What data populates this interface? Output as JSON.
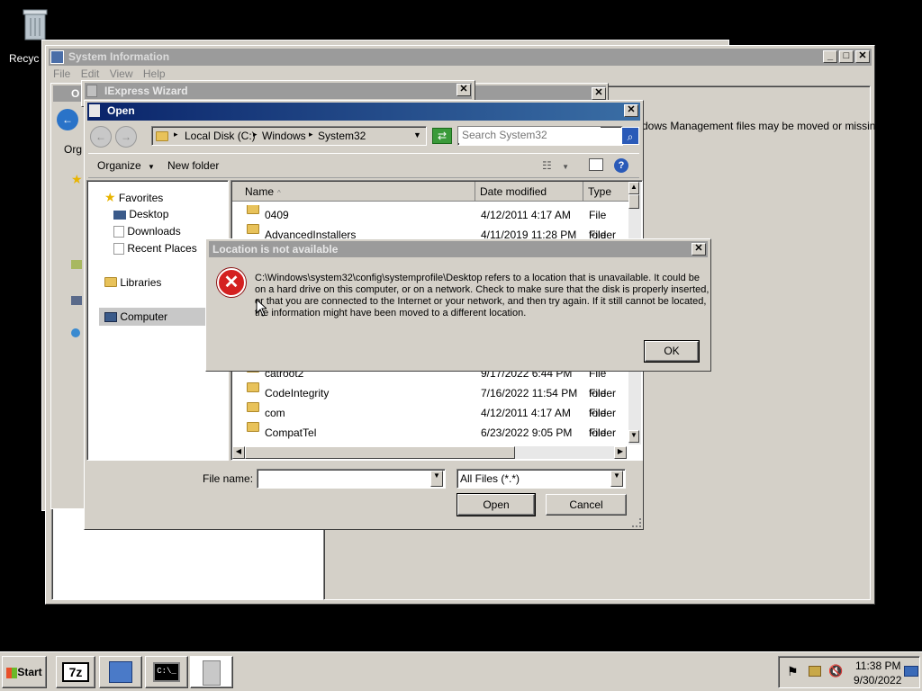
{
  "desktop": {
    "recycle_label": "Recyc"
  },
  "sysinfo": {
    "title": "System Information",
    "menu": [
      "File",
      "Edit",
      "View",
      "Help"
    ],
    "sub_title": "O",
    "left_partial": "Org",
    "right_message": "dows Management files may be moved or missing."
  },
  "iexpress": {
    "title": "IExpress Wizard"
  },
  "open": {
    "title": "Open",
    "path": [
      "Local Disk (C:)",
      "Windows",
      "System32"
    ],
    "search_placeholder": "Search System32",
    "organize_label": "Organize",
    "new_folder_label": "New folder",
    "nav": {
      "favorites": "Favorites",
      "desktop": "Desktop",
      "downloads": "Downloads",
      "recent": "Recent Places",
      "libraries": "Libraries",
      "computer": "Computer"
    },
    "columns": {
      "name": "Name",
      "date": "Date modified",
      "type": "Type"
    },
    "rows_top": [
      {
        "name": "0409",
        "date": "4/12/2011 4:17 AM",
        "type": "File folder"
      },
      {
        "name": "AdvancedInstallers",
        "date": "4/11/2019 11:28 PM",
        "type": "File folder"
      }
    ],
    "rows_bottom": [
      {
        "name": "catroot2",
        "date": "9/17/2022 6:44 PM",
        "type": "File folder"
      },
      {
        "name": "CodeIntegrity",
        "date": "7/16/2022 11:54 PM",
        "type": "File folder"
      },
      {
        "name": "com",
        "date": "4/12/2011 4:17 AM",
        "type": "File folder"
      },
      {
        "name": "CompatTel",
        "date": "6/23/2022 9:05 PM",
        "type": "File folder"
      }
    ],
    "filename_label": "File name:",
    "filename_value": "",
    "filetype_value": "All Files (*.*)",
    "open_label": "Open",
    "cancel_label": "Cancel"
  },
  "error": {
    "title": "Location is not available",
    "lines": [
      "C:\\Windows\\system32\\config\\systemprofile\\Desktop refers to a location that is unavailable. It could be",
      "on a hard drive on this computer, or on a network. Check to make sure that the disk is properly inserted,",
      "or that you are connected to the Internet or your network, and then try again. If it still cannot be located,",
      "the information might have been moved to a different location."
    ],
    "ok_label": "OK"
  },
  "taskbar": {
    "start_label": "Start",
    "app_7z_label": "7z",
    "time": "11:38 PM",
    "date": "9/30/2022"
  },
  "colors": {
    "title_active": "#0a246a",
    "error_red": "#d42020",
    "desktop": "#000000"
  }
}
